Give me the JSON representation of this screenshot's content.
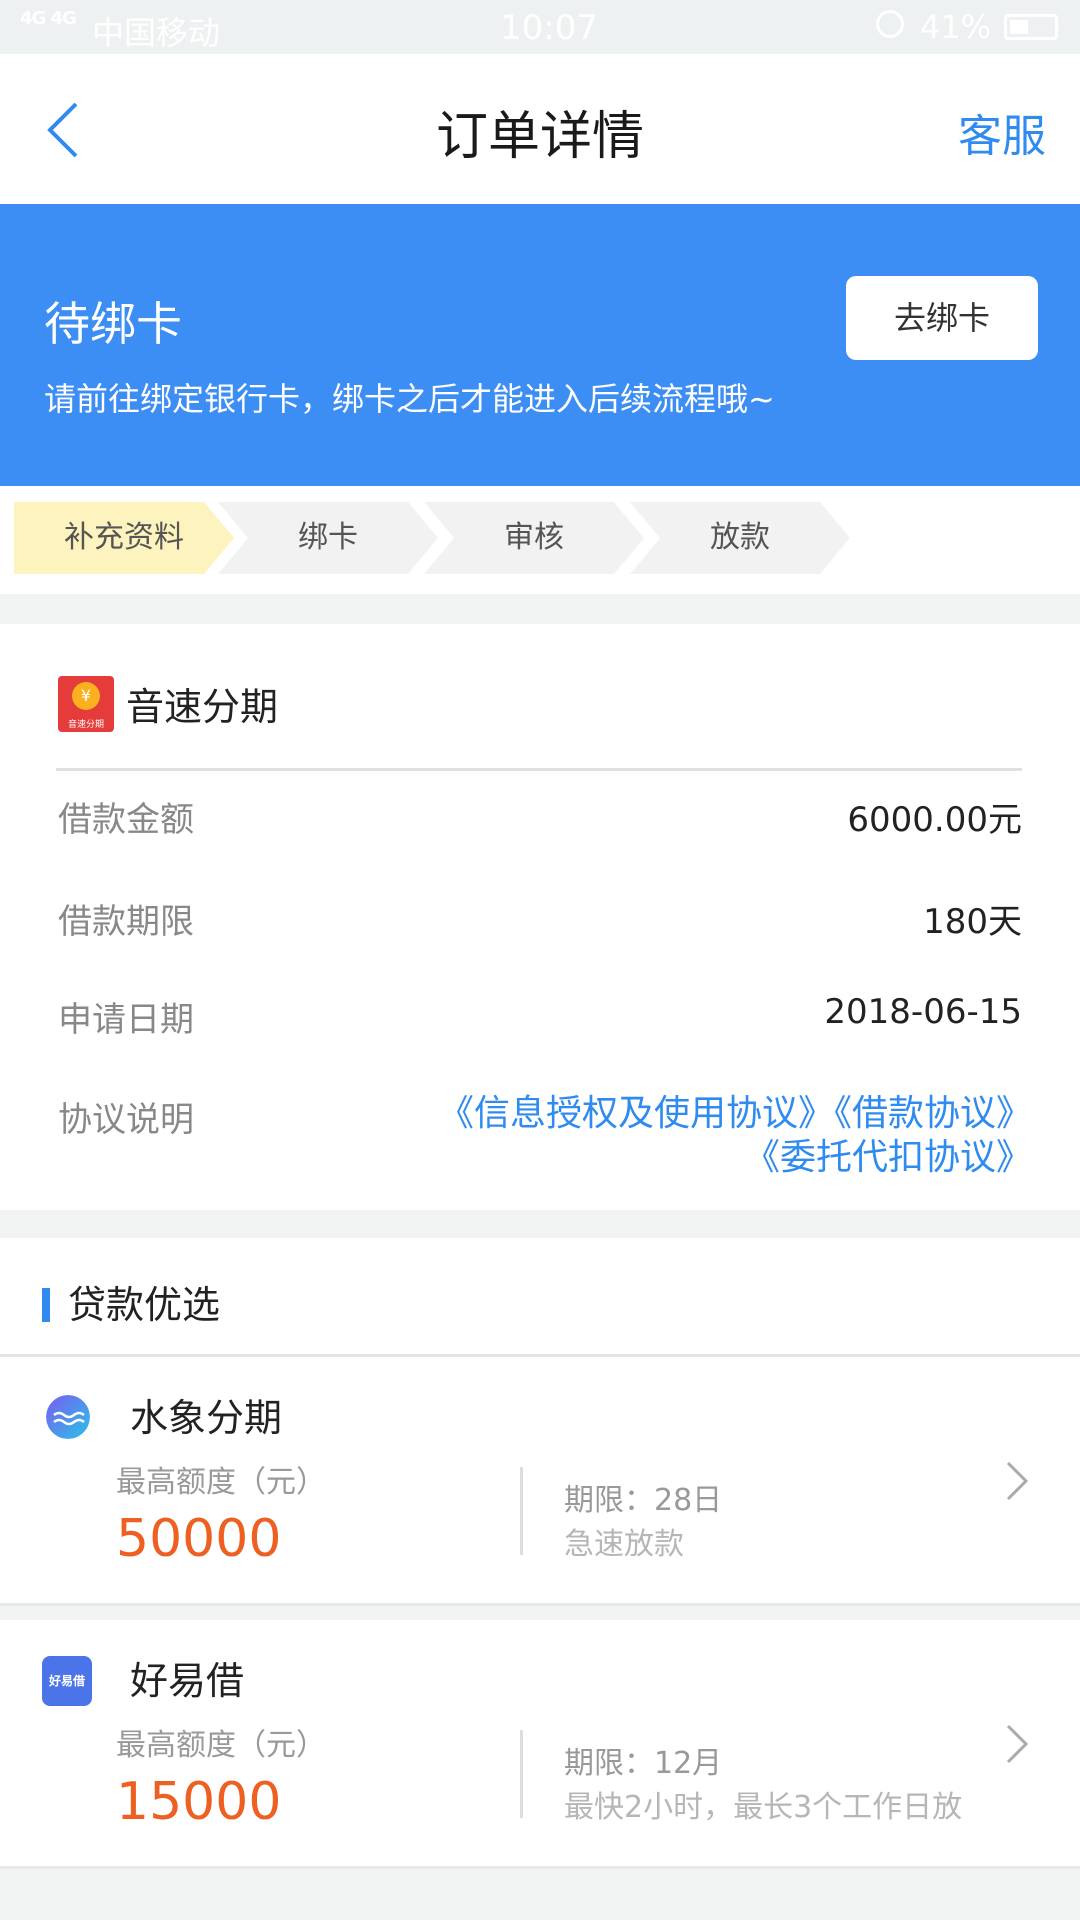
{
  "status_bar": {
    "signal": "4G 4G",
    "carrier": "中国移动",
    "time": "10:07",
    "battery": "41%"
  },
  "header": {
    "title": "订单详情",
    "service": "客服"
  },
  "banner": {
    "status": "待绑卡",
    "message": "请前往绑定银行卡，绑卡之后才能进入后续流程哦~",
    "button": "去绑卡",
    "color": "#3c8ef4"
  },
  "steps": [
    {
      "label": "补充资料",
      "active": true
    },
    {
      "label": "绑卡",
      "active": false
    },
    {
      "label": "审核",
      "active": false
    },
    {
      "label": "放款",
      "active": false
    }
  ],
  "order": {
    "logo_text": "音速分期",
    "logo_symbol": "¥",
    "product": "音速分期",
    "rows": [
      {
        "label": "借款金额",
        "value": "6000.00元"
      },
      {
        "label": "借款期限",
        "value": "180天"
      },
      {
        "label": "申请日期",
        "value": "2018-06-15"
      }
    ],
    "agreement_label": "协议说明",
    "agreements_line1": "《信息授权及使用协议》《借款协议》",
    "agreements_line2": "《委托代扣协议》"
  },
  "recommend": {
    "title": "贷款优选",
    "items": [
      {
        "name": "水象分期",
        "max_label": "最高额度（元）",
        "amount": "50000",
        "term": "期限：28日",
        "desc": "急速放款",
        "icon": "wave-logo-icon"
      },
      {
        "name": "好易借",
        "logo_text": "好易借",
        "max_label": "最高额度（元）",
        "amount": "15000",
        "term": "期限：12月",
        "desc": "最快2小时，最长3个工作日放",
        "icon": "haoyijie-logo-icon"
      }
    ]
  }
}
